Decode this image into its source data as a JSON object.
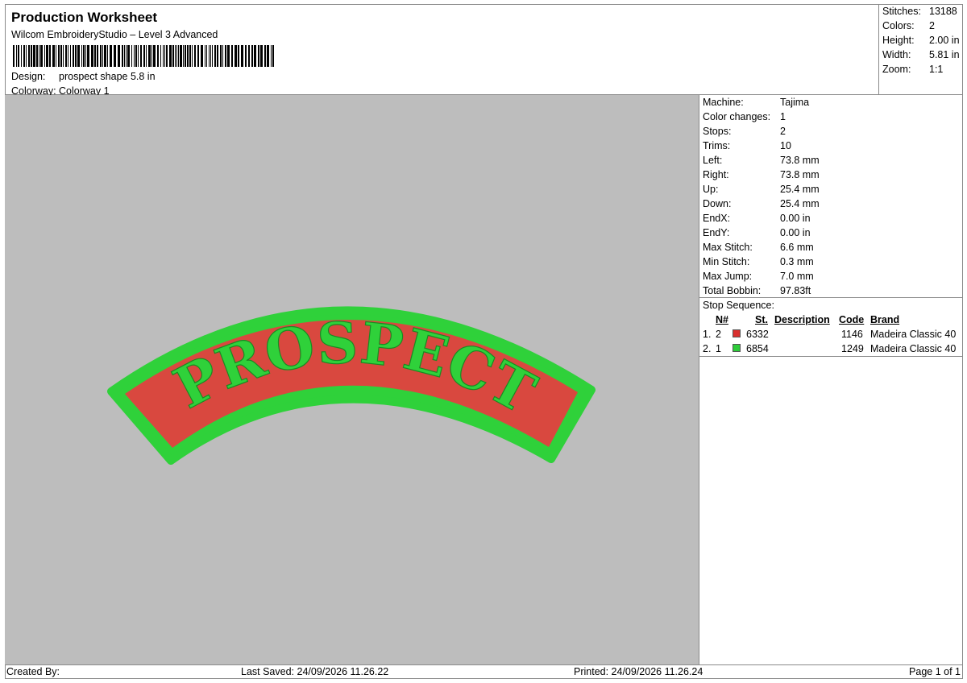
{
  "header": {
    "title": "Production Worksheet",
    "software": "Wilcom EmbroideryStudio – Level 3 Advanced",
    "design_label": "Design:",
    "design_value": "prospect shape 5.8 in",
    "colorway_label": "Colorway:",
    "colorway_value": "Colorway 1"
  },
  "summary": [
    {
      "label": "Stitches:",
      "value": "13188"
    },
    {
      "label": "Colors:",
      "value": "2"
    },
    {
      "label": "Height:",
      "value": "2.00 in"
    },
    {
      "label": "Width:",
      "value": "5.81 in"
    },
    {
      "label": "Zoom:",
      "value": "1:1"
    }
  ],
  "machine_info": [
    {
      "label": "Machine:",
      "value": "Tajima"
    },
    {
      "label": "Color changes:",
      "value": "1"
    },
    {
      "label": "Stops:",
      "value": "2"
    },
    {
      "label": "Trims:",
      "value": "10"
    },
    {
      "label": "Left:",
      "value": "73.8 mm"
    },
    {
      "label": "Right:",
      "value": "73.8 mm"
    },
    {
      "label": "Up:",
      "value": "25.4 mm"
    },
    {
      "label": "Down:",
      "value": "25.4 mm"
    },
    {
      "label": "EndX:",
      "value": "0.00 in"
    },
    {
      "label": "EndY:",
      "value": "0.00 in"
    },
    {
      "label": "Max Stitch:",
      "value": "6.6 mm"
    },
    {
      "label": "Min Stitch:",
      "value": "0.3 mm"
    },
    {
      "label": "Max Jump:",
      "value": "7.0 mm"
    },
    {
      "label": "Total Bobbin:",
      "value": "97.83ft"
    }
  ],
  "stop_sequence": {
    "title": "Stop Sequence:",
    "columns": {
      "n": "N#",
      "st": "St.",
      "description": "Description",
      "code": "Code",
      "brand": "Brand"
    },
    "rows": [
      {
        "index": "1.",
        "n": "2",
        "color": "#d9302f",
        "st": "6332",
        "description": "",
        "code": "1146",
        "brand": "Madeira Classic 40"
      },
      {
        "index": "2.",
        "n": "1",
        "color": "#2ecc3a",
        "st": "6854",
        "description": "",
        "code": "1249",
        "brand": "Madeira Classic 40"
      }
    ]
  },
  "design": {
    "text": "PROSPECT",
    "fill_color": "#d9483f",
    "border_color": "#2fd13a"
  },
  "footer": {
    "created_by": "Created By:",
    "last_saved": "Last Saved: 24/09/2026 11.26.22",
    "printed": "Printed: 24/09/2026 11.26.24",
    "page": "Page 1 of 1"
  }
}
